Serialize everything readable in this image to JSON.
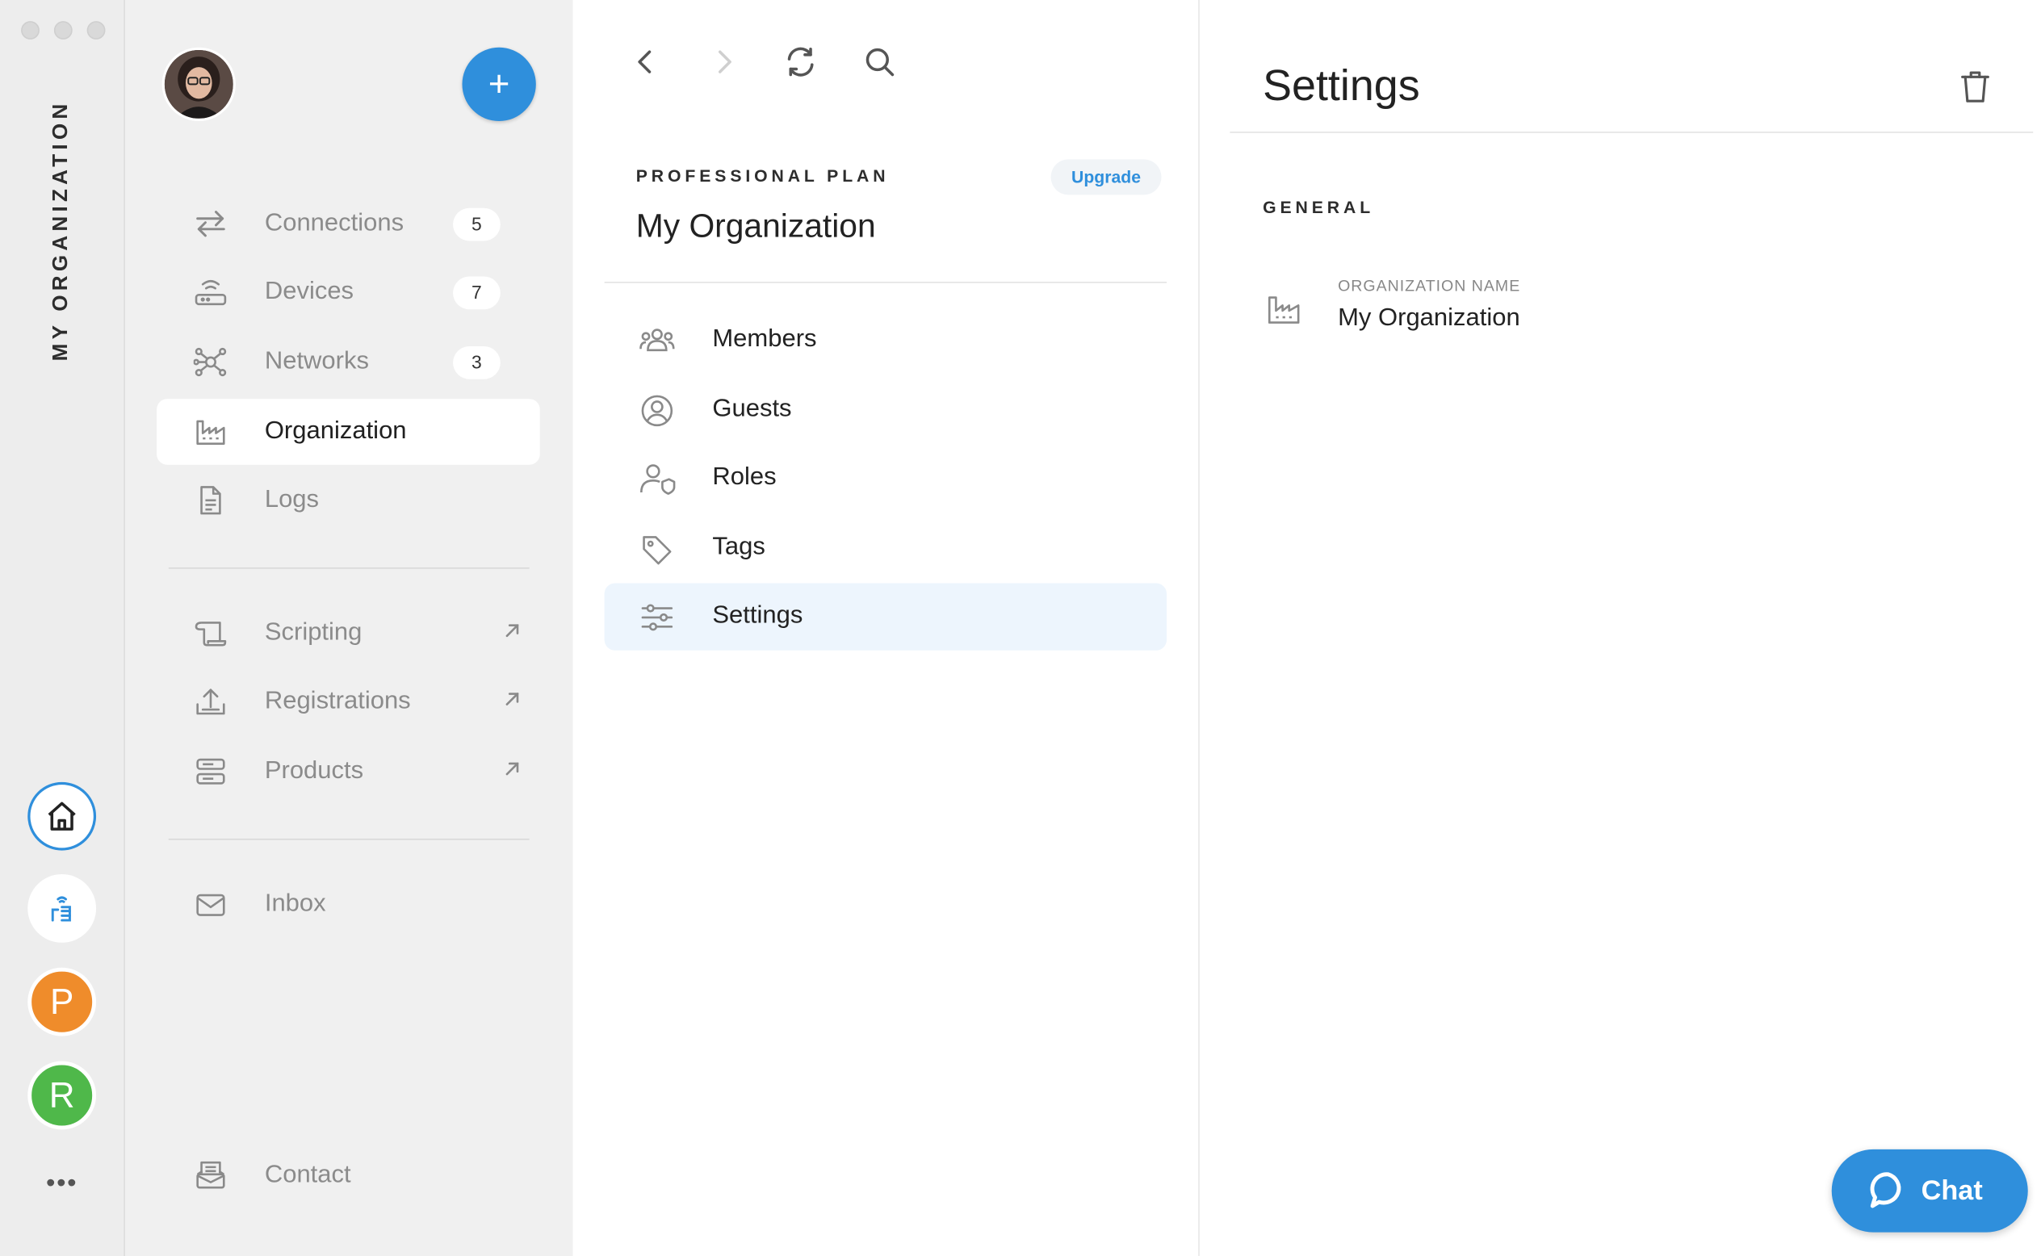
{
  "rail": {
    "org_label": "MY ORGANIZATION",
    "workspaces": [
      "P",
      "R"
    ],
    "more": "•••"
  },
  "sidebar": {
    "add_button": "+",
    "items": [
      {
        "label": "Connections",
        "badge": "5",
        "icon": "arrows-swap-icon"
      },
      {
        "label": "Devices",
        "badge": "7",
        "icon": "router-icon"
      },
      {
        "label": "Networks",
        "badge": "3",
        "icon": "network-nodes-icon"
      },
      {
        "label": "Organization",
        "icon": "factory-icon",
        "active": true
      },
      {
        "label": "Logs",
        "icon": "document-icon"
      }
    ],
    "external_items": [
      {
        "label": "Scripting",
        "icon": "scroll-icon"
      },
      {
        "label": "Registrations",
        "icon": "upload-icon"
      },
      {
        "label": "Products",
        "icon": "server-icon"
      }
    ],
    "inbox": "Inbox",
    "contact": "Contact"
  },
  "middle": {
    "plan": "PROFESSIONAL PLAN",
    "upgrade": "Upgrade",
    "org_name": "My Organization",
    "items": [
      {
        "label": "Members",
        "icon": "people-icon"
      },
      {
        "label": "Guests",
        "icon": "user-circle-icon"
      },
      {
        "label": "Roles",
        "icon": "user-shield-icon"
      },
      {
        "label": "Tags",
        "icon": "tag-icon"
      },
      {
        "label": "Settings",
        "icon": "sliders-icon",
        "active": true
      }
    ]
  },
  "right": {
    "title": "Settings",
    "section": "GENERAL",
    "field_label": "ORGANIZATION NAME",
    "field_value": "My Organization",
    "chat": "Chat"
  },
  "colors": {
    "accent": "#2f8fdc",
    "workspace_p": "#ef8c2b",
    "workspace_r": "#4fb84a",
    "active_row": "#edf5fd"
  }
}
